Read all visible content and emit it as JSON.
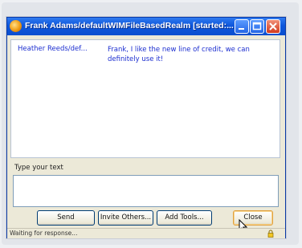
{
  "window": {
    "title": "Frank Adams/defaultWIMFileBasedRealm [started:...",
    "title_icon": "chat-app-icon",
    "controls": {
      "minimize": "minimize-icon",
      "maximize": "maximize-icon",
      "close": "close-icon"
    }
  },
  "transcript": {
    "messages": [
      {
        "sender": "Heather Reeds/def...",
        "text": "Frank, I like the new line of credit, we can definitely use it!"
      }
    ]
  },
  "compose": {
    "label": "Type your text",
    "value": ""
  },
  "buttons": {
    "send": "Send",
    "invite": "Invite Others...",
    "tools": "Add Tools...",
    "close": "Close"
  },
  "status": {
    "text": "Waiting for response...",
    "icon": "lock-icon"
  },
  "colors": {
    "titlebar": "#0e57dc",
    "message_text": "#1c2ed0",
    "window_bg": "#ece9d8"
  }
}
